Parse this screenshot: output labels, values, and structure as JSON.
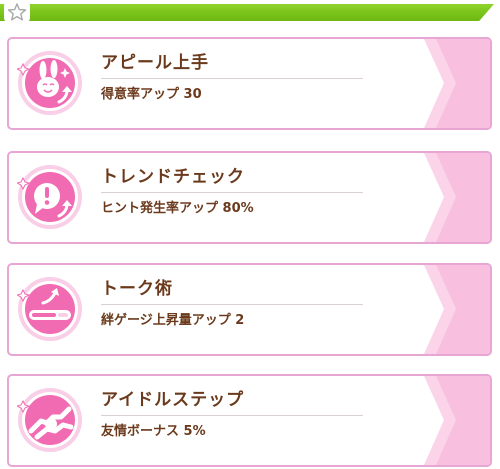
{
  "skills": [
    {
      "name": "アピール上手",
      "effect": "得意率アップ 30",
      "icon": "smiling-bunny-icon"
    },
    {
      "name": "トレンドチェック",
      "effect": "ヒント発生率アップ 80%",
      "icon": "exclamation-icon"
    },
    {
      "name": "トーク術",
      "effect": "絆ゲージ上昇量アップ 2",
      "icon": "bond-gauge-icon"
    },
    {
      "name": "アイドルステップ",
      "effect": "友情ボーナス 5%",
      "icon": "handshake-icon"
    }
  ],
  "colors": {
    "header_green": "#79c31a",
    "card_border": "#e8a6d4",
    "icon_pink": "#f06bb1",
    "text_brown": "#6b3a1c"
  }
}
